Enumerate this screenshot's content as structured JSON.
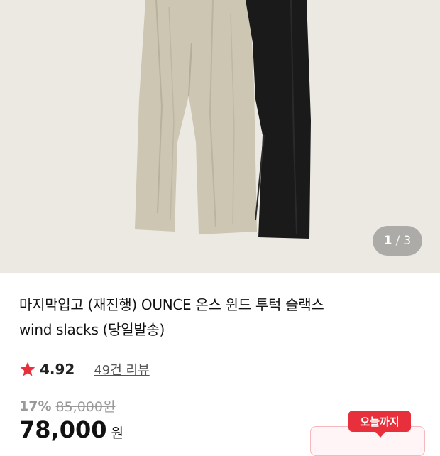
{
  "gallery": {
    "current": "1",
    "separator": "/",
    "total": "3"
  },
  "product": {
    "title_line1": "마지막입고 (재진행) OUNCE 온스 윈드 투턱 슬랙스",
    "title_line2": "wind slacks (당일발송)"
  },
  "rating": {
    "score": "4.92",
    "reviews": "49건 리뷰"
  },
  "pricing": {
    "discount": "17%",
    "original_price": "85,000원",
    "price": "78,000",
    "unit": "원",
    "badge": "오늘까지"
  },
  "colors": {
    "accent": "#e8303c",
    "star": "#e8303c"
  }
}
